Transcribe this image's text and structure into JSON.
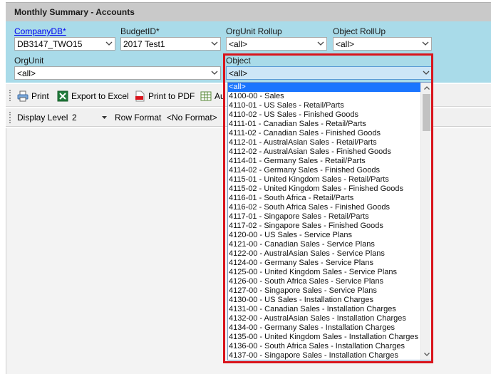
{
  "window": {
    "title": "Monthly Summary - Accounts"
  },
  "filters": {
    "company": {
      "label": "CompanyDB*",
      "value": "DB3147_TWO15"
    },
    "budget": {
      "label": "BudgetID*",
      "value": "2017 Test1"
    },
    "orgunit_rollup": {
      "label": "OrgUnit Rollup",
      "value": "<all>"
    },
    "object_rollup": {
      "label": "Object RollUp",
      "value": "<all>"
    },
    "orgunit": {
      "label": "OrgUnit",
      "value": "<all>"
    },
    "object": {
      "label": "Object",
      "value": "<all>"
    }
  },
  "toolbar": {
    "print_label": "Print",
    "export_excel_label": "Export to Excel",
    "print_pdf_label": "Print to PDF",
    "truncated_label": "Au"
  },
  "toolbar2": {
    "display_level_label": "Display Level",
    "display_level_value": "2",
    "row_format_label": "Row Format",
    "row_format_value": "<No Format>"
  },
  "object_dropdown": {
    "selected_index": 0,
    "items": [
      "<all>",
      "4100-00 - Sales",
      "4110-01 - US Sales - Retail/Parts",
      "4110-02 - US Sales - Finished Goods",
      "4111-01 - Canadian Sales - Retail/Parts",
      "4111-02 - Canadian Sales - Finished Goods",
      "4112-01 - AustralAsian Sales - Retail/Parts",
      "4112-02 - AustralAsian Sales - Finished Goods",
      "4114-01 - Germany Sales - Retail/Parts",
      "4114-02 - Germany Sales - Finished Goods",
      "4115-01 - United Kingdom Sales - Retail/Parts",
      "4115-02 - United Kingdom Sales - Finished Goods",
      "4116-01 - South Africa - Retail/Parts",
      "4116-02 - South Africa Sales - Finished Goods",
      "4117-01 - Singapore Sales - Retail/Parts",
      "4117-02 - Singapore Sales - Finished Goods",
      "4120-00 - US Sales - Service Plans",
      "4121-00 - Canadian Sales - Service Plans",
      "4122-00 - AustralAsian Sales - Service Plans",
      "4124-00 - Germany Sales - Service Plans",
      "4125-00 - United Kingdom Sales - Service Plans",
      "4126-00 - South Africa Sales - Service Plans",
      "4127-00 - Singapore Sales - Service Plans",
      "4130-00 - US Sales - Installation Charges",
      "4131-00 - Canadian Sales - Installation Charges",
      "4132-00 - AustralAsian Sales - Installation Charges",
      "4134-00 - Germany Sales - Installation Charges",
      "4135-00 - United Kingdom Sales - Installation Charges",
      "4136-00 - South Africa Sales - Installation Charges",
      "4137-00 - Singapore Sales - Installation Charges"
    ]
  },
  "colors": {
    "highlight": "#d9141c",
    "panel": "#a9dbe9",
    "selection": "#1a75ff"
  }
}
